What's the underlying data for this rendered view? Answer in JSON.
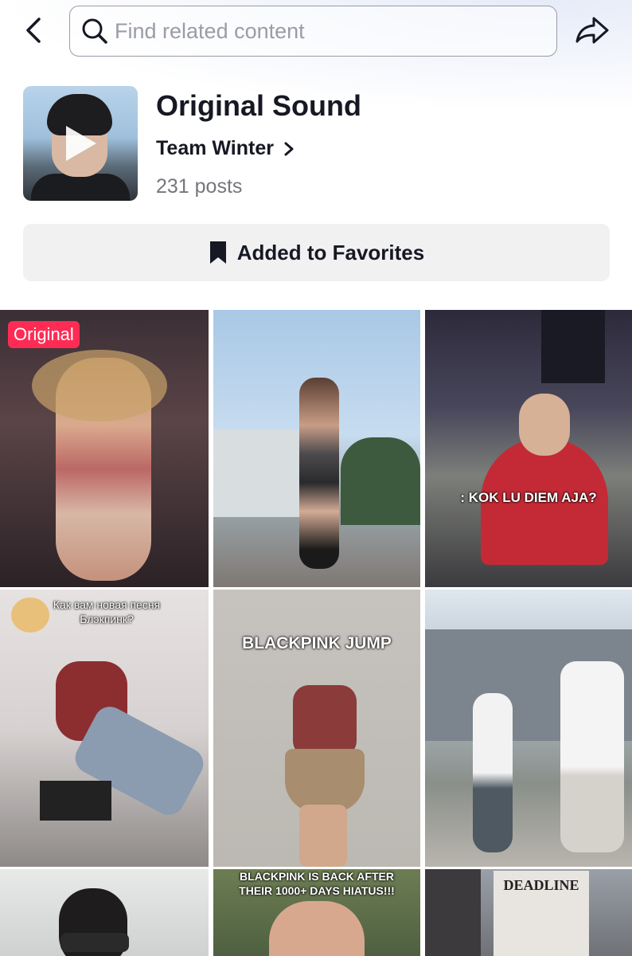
{
  "search": {
    "placeholder": "Find related content"
  },
  "sound": {
    "title": "Original Sound",
    "author": "Team Winter",
    "posts": "231 posts"
  },
  "favorites": {
    "label": "Added to Favorites"
  },
  "grid": {
    "tiles": [
      {
        "badge": "Original",
        "caption": ""
      },
      {
        "badge": "",
        "caption": ""
      },
      {
        "badge": "",
        "caption": ": KOK LU DIEM AJA?"
      },
      {
        "badge": "",
        "caption": "Как вам новая песня Блэкпинк?"
      },
      {
        "badge": "",
        "caption": "BLACKPINK JUMP"
      },
      {
        "badge": "",
        "caption": ""
      },
      {
        "badge": "",
        "caption": ""
      },
      {
        "badge": "",
        "caption": "BLACKPINK IS BACK AFTER THEIR 1000+ DAYS HIATUS!!!"
      },
      {
        "badge": "",
        "caption": "DEADLINE"
      }
    ]
  },
  "colors": {
    "accent_badge": "#fe2c55",
    "button_bg": "#f1f1f2",
    "muted_text": "#75767d"
  },
  "icons": [
    "back-icon",
    "search-icon",
    "share-icon",
    "play-icon",
    "chevron-right-icon",
    "bookmark-icon"
  ]
}
